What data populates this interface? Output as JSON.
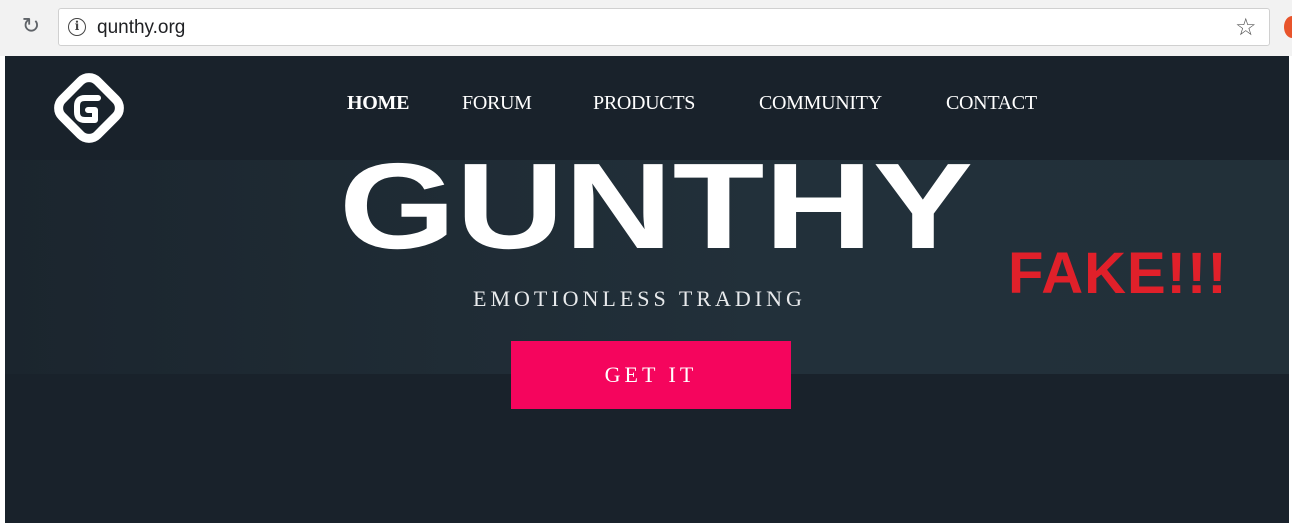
{
  "browser": {
    "url": "qunthy.org",
    "icons": {
      "reload": "reload-icon",
      "info": "info-icon",
      "bookmark": "star-icon",
      "extension": "extension-icon"
    }
  },
  "site": {
    "nav": [
      {
        "label": "HOME",
        "active": true
      },
      {
        "label": "FORUM",
        "active": false
      },
      {
        "label": "PRODUCTS",
        "active": false
      },
      {
        "label": "COMMUNITY",
        "active": false
      },
      {
        "label": "CONTACT",
        "active": false
      }
    ],
    "brand": "GUNTHY",
    "tagline": "EMOTIONLESS TRADING",
    "cta_label": "GET IT"
  },
  "annotation": {
    "text": "FAKE!!!"
  },
  "colors": {
    "page_bg": "#19222b",
    "cta_bg": "#f5055d",
    "annotation": "#e0202a",
    "text": "#ffffff"
  }
}
